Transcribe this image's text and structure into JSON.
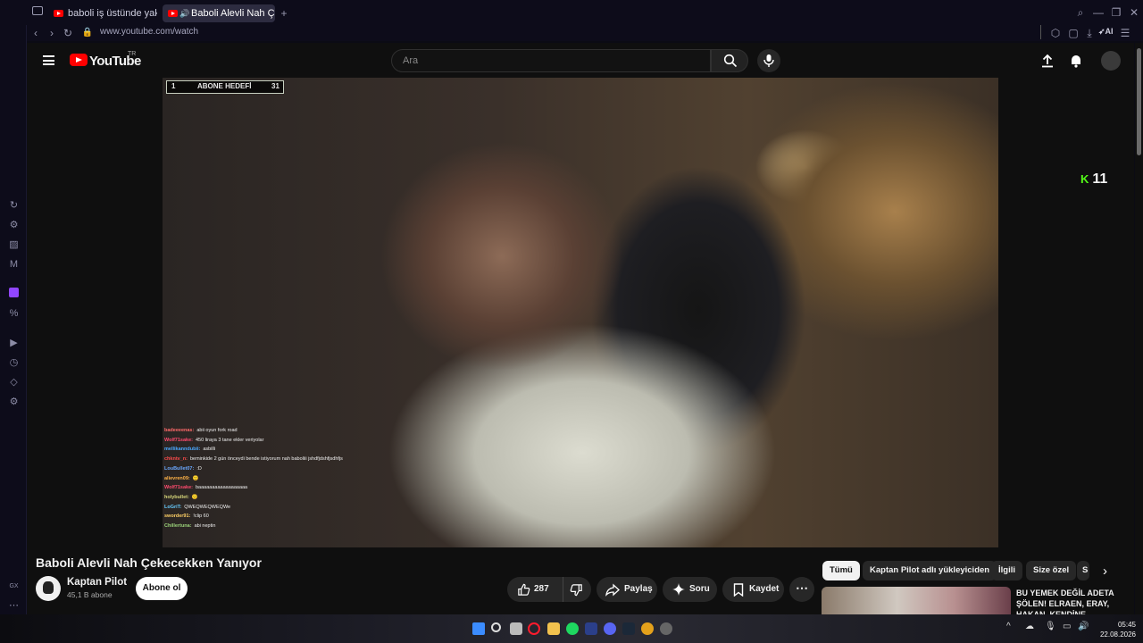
{
  "browser": {
    "tabs": [
      {
        "title": "baboli iş üstünde yakalnıyor",
        "active": false
      },
      {
        "title": "Baboli Alevli Nah Çekecek",
        "active": true
      }
    ],
    "url": "www.youtube.com/watch",
    "ai_label": "AI",
    "sidebar_bottom_label": "GX"
  },
  "youtube": {
    "wordmark": "YouTube",
    "country": "TR",
    "search_placeholder": "Ara"
  },
  "video": {
    "overlay": {
      "goal_left": "1",
      "goal_label": "ABONE HEDEFİ",
      "goal_right": "31"
    },
    "chat": [
      {
        "user": "badeeeenas:",
        "color": "#ff6a6a",
        "msg": "abii oyun fork road"
      },
      {
        "user": "Wolf71sake:",
        "color": "#ff4b6e",
        "msg": "450 liraya 3 tane ekler veriyolar"
      },
      {
        "user": "mellikanndubii:",
        "color": "#4aa8ff",
        "msg": "asbilli"
      },
      {
        "user": "chkntv_n:",
        "color": "#ff4b4b",
        "msg": "beminkide 2 gün önceydi bende istiyorum nah baboliii jshdfjdshfjsdhfjsdhj"
      },
      {
        "user": "LouBullet07:",
        "color": "#6aa8ff",
        "msg": ":D"
      },
      {
        "user": "alievren09:",
        "color": "#ffb347",
        "msg": "🙂"
      },
      {
        "user": "Wolf71sake:",
        "color": "#ff4b6e",
        "msg": "baaaaaaaaaaaaaaaaaa"
      },
      {
        "user": "holybullet:",
        "color": "#d7d77a",
        "msg": "🙂"
      },
      {
        "user": "LoGriT:",
        "color": "#66ccff",
        "msg": "QWEQWEQWEQWe"
      },
      {
        "user": "sworder91:",
        "color": "#ffd166",
        "msg": "!clip 60"
      },
      {
        "user": "Chillertuna:",
        "color": "#9bd47a",
        "msg": "abi neptin"
      }
    ],
    "side_badge": "11",
    "title": "Baboli Alevli Nah Çekecekken Yanıyor",
    "channel_name": "Kaptan Pilot",
    "subscribers": "45,1 B abone",
    "subscribe_label": "Abone ol",
    "likes": "287",
    "share_label": "Paylaş",
    "ask_label": "Soru",
    "save_label": "Kaydet"
  },
  "chips": [
    "Tümü",
    "Kaptan Pilot adlı yükleyiciden",
    "İlgili",
    "Size özel",
    "S"
  ],
  "recommendation": {
    "title": "BU YEMEK DEĞİL ADETA ŞÖLEN! ELRAEN, ERAY, HAKAN, KENDİNE..."
  },
  "taskbar": {
    "time": "05:45",
    "date": "22.08.2026"
  },
  "colors": {
    "youtube_red": "#ff0000",
    "kick_green": "#53fc18",
    "page_bg": "#0f0f0f"
  }
}
